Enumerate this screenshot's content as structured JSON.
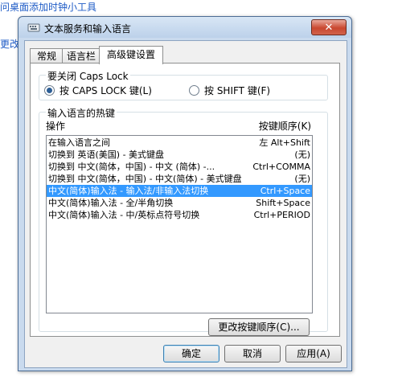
{
  "background": {
    "line1": "问桌面添加时钟小工具",
    "line2": "更改"
  },
  "window": {
    "title": "文本服务和输入语言",
    "close_icon": "close-icon",
    "close_symbol": "✕"
  },
  "tabs": [
    {
      "label": "常规",
      "active": false
    },
    {
      "label": "语言栏",
      "active": false
    },
    {
      "label": "高级键设置",
      "active": true
    }
  ],
  "caps_lock": {
    "group_label": "要关闭 Caps Lock",
    "options": [
      {
        "label": "按 CAPS LOCK 键(L)",
        "selected": true
      },
      {
        "label": "按 SHIFT 键(F)",
        "selected": false
      }
    ]
  },
  "hotkeys": {
    "group_label": "输入语言的热键",
    "header": {
      "action": "操作",
      "keys": "按键顺序(K)"
    },
    "rows": [
      {
        "action": "在输入语言之间",
        "keys": "左 Alt+Shift",
        "selected": false
      },
      {
        "action": "切换到 英语(美国) - 美式键盘",
        "keys": "(无)",
        "selected": false
      },
      {
        "action": "切换到 中文(简体，中国) - 中文 (简体) -...",
        "keys": "Ctrl+COMMA",
        "selected": false
      },
      {
        "action": "切换到 中文(简体，中国) - 中文(简体) - 美式键盘",
        "keys": "(无)",
        "selected": false
      },
      {
        "action": "中文(简体)输入法 - 输入法/非输入法切换",
        "keys": "Ctrl+Space",
        "selected": true
      },
      {
        "action": "中文(简体)输入法 - 全/半角切换",
        "keys": "Shift+Space",
        "selected": false
      },
      {
        "action": "中文(简体)输入法 - 中/英标点符号切换",
        "keys": "Ctrl+PERIOD",
        "selected": false
      }
    ],
    "change_button": "更改按键顺序(C)..."
  },
  "buttons": {
    "ok": "确定",
    "cancel": "取消",
    "apply": "应用(A)"
  },
  "colors": {
    "selection": "#3399ff",
    "link": "#1e5bc6",
    "close": "#c9472f"
  }
}
